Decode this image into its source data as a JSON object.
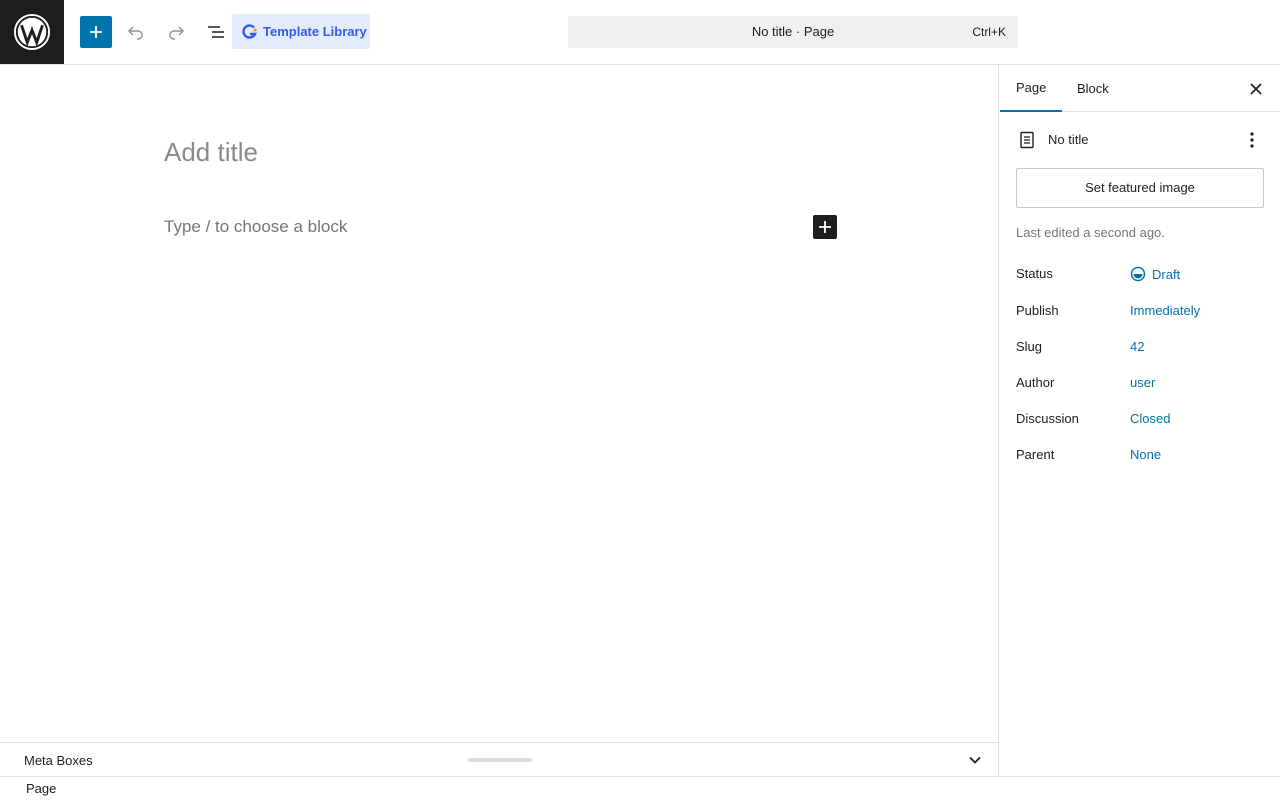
{
  "header": {
    "logo_icon": "wordpress-logo-icon",
    "add_block_icon": "plus-icon",
    "undo_icon": "undo-icon",
    "redo_icon": "redo-icon",
    "list_view_icon": "list-view-icon",
    "template_library_label": "Template Library",
    "command_bar_title": "No title · Page",
    "command_bar_shortcut": "Ctrl+K"
  },
  "editor": {
    "title_placeholder": "Add title",
    "block_placeholder": "Type / to choose a block"
  },
  "meta_boxes": {
    "label": "Meta Boxes"
  },
  "footer": {
    "breadcrumb": "Page"
  },
  "sidebar": {
    "tabs": [
      {
        "label": "Page",
        "active": true
      },
      {
        "label": "Block",
        "active": false
      }
    ],
    "document_title": "No title",
    "featured_image_label": "Set featured image",
    "last_edited": "Last edited a second ago.",
    "properties": [
      {
        "label": "Status",
        "value": "Draft"
      },
      {
        "label": "Publish",
        "value": "Immediately"
      },
      {
        "label": "Slug",
        "value": "42"
      },
      {
        "label": "Author",
        "value": "user"
      },
      {
        "label": "Discussion",
        "value": "Closed"
      },
      {
        "label": "Parent",
        "value": "None"
      }
    ]
  },
  "colors": {
    "accent": "#0073aa",
    "dark": "#1e1e1e",
    "template_library_bg": "#e3ecfb",
    "template_library_text": "#3858e9"
  }
}
